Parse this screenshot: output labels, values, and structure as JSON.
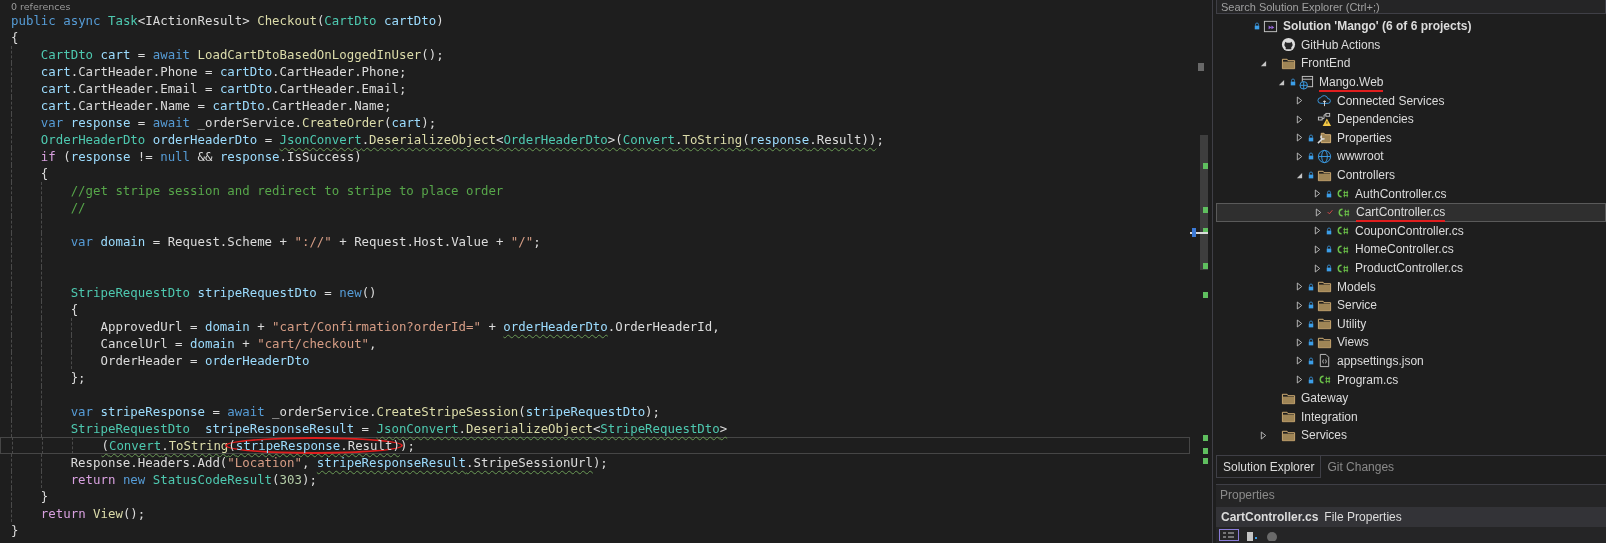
{
  "editor": {
    "lines": [
      {
        "kind": "codelens",
        "text": "0 references"
      },
      {
        "kind": "code",
        "tokens": [
          {
            "kind": "keyword",
            "text": "public async "
          },
          {
            "kind": "type",
            "text": "Task"
          },
          {
            "kind": "plain",
            "text": "<IActionResult> "
          },
          {
            "kind": "method",
            "text": "Checkout"
          },
          {
            "kind": "plain",
            "text": "("
          },
          {
            "kind": "type",
            "text": "CartDto"
          },
          {
            "kind": "variable",
            "text": " cartDto"
          },
          {
            "kind": "plain",
            "text": ")"
          }
        ]
      },
      {
        "kind": "code",
        "tokens": [
          {
            "kind": "plain",
            "text": "{"
          }
        ]
      },
      {
        "kind": "block",
        "lines": [
          {
            "kind": "code",
            "tokens": [
              {
                "kind": "type",
                "text": "CartDto"
              },
              {
                "kind": "variable",
                "text": " cart"
              },
              {
                "kind": "plain",
                "text": " = "
              },
              {
                "kind": "keyword",
                "text": "await "
              },
              {
                "kind": "method",
                "text": "LoadCartDtoBasedOnLoggedInUser"
              },
              {
                "kind": "plain",
                "text": "();"
              }
            ]
          },
          {
            "kind": "code",
            "tokens": [
              {
                "kind": "variable",
                "text": "cart"
              },
              {
                "kind": "plain",
                "text": ".CartHeader.Phone = "
              },
              {
                "kind": "variable",
                "text": "cartDto"
              },
              {
                "kind": "plain",
                "text": ".CartHeader.Phone;"
              }
            ]
          },
          {
            "kind": "code",
            "tokens": [
              {
                "kind": "variable",
                "text": "cart"
              },
              {
                "kind": "plain",
                "text": ".CartHeader.Email = "
              },
              {
                "kind": "variable",
                "text": "cartDto"
              },
              {
                "kind": "plain",
                "text": ".CartHeader.Email;"
              }
            ]
          },
          {
            "kind": "code",
            "tokens": [
              {
                "kind": "variable",
                "text": "cart"
              },
              {
                "kind": "plain",
                "text": ".CartHeader.Name = "
              },
              {
                "kind": "variable",
                "text": "cartDto"
              },
              {
                "kind": "plain",
                "text": ".CartHeader.Name;"
              }
            ]
          },
          {
            "kind": "code",
            "tokens": [
              {
                "kind": "keyword",
                "text": "var "
              },
              {
                "kind": "variable",
                "text": "response"
              },
              {
                "kind": "plain",
                "text": " = "
              },
              {
                "kind": "keyword",
                "text": "await "
              },
              {
                "kind": "plain",
                "text": "_orderService."
              },
              {
                "kind": "method",
                "text": "CreateOrder"
              },
              {
                "kind": "plain",
                "text": "("
              },
              {
                "kind": "variable",
                "text": "cart"
              },
              {
                "kind": "plain",
                "text": ");"
              }
            ]
          },
          {
            "kind": "code",
            "tokens": [
              {
                "kind": "type",
                "text": "OrderHeaderDto"
              },
              {
                "kind": "variable",
                "text": " orderHeaderDto"
              },
              {
                "kind": "plain",
                "text": " = "
              },
              {
                "kind": "type",
                "text": "JsonConvert",
                "squiggle": true
              },
              {
                "kind": "plain",
                "text": ".",
                "squiggle": true
              },
              {
                "kind": "method",
                "text": "DeserializeObject",
                "squiggle": true
              },
              {
                "kind": "plain",
                "text": "<",
                "squiggle": true
              },
              {
                "kind": "type",
                "text": "OrderHeaderDto",
                "squiggle": true
              },
              {
                "kind": "plain",
                "text": ">(",
                "squiggle": true
              },
              {
                "kind": "type",
                "text": "Convert",
                "squiggle": true
              },
              {
                "kind": "plain",
                "text": ".",
                "squiggle": true
              },
              {
                "kind": "method",
                "text": "ToString",
                "squiggle": true
              },
              {
                "kind": "plain",
                "text": "(",
                "squiggle": true
              },
              {
                "kind": "variable",
                "text": "response",
                "squiggle": true
              },
              {
                "kind": "plain",
                "text": ".Result))",
                "squiggle": true
              },
              {
                "kind": "plain",
                "text": ";"
              }
            ]
          },
          {
            "kind": "code",
            "tokens": [
              {
                "kind": "control",
                "text": "if"
              },
              {
                "kind": "plain",
                "text": " ("
              },
              {
                "kind": "variable",
                "text": "response"
              },
              {
                "kind": "plain",
                "text": " != "
              },
              {
                "kind": "keyword",
                "text": "null"
              },
              {
                "kind": "plain",
                "text": " && "
              },
              {
                "kind": "variable",
                "text": "response"
              },
              {
                "kind": "plain",
                "text": ".IsSuccess)"
              }
            ]
          },
          {
            "kind": "code",
            "tokens": [
              {
                "kind": "plain",
                "text": "{"
              }
            ]
          },
          {
            "kind": "block",
            "lines": [
              {
                "kind": "code",
                "tokens": [
                  {
                    "kind": "comment",
                    "text": "//get stripe session and redirect to stripe to place order"
                  }
                ]
              },
              {
                "kind": "code",
                "tokens": [
                  {
                    "kind": "comment",
                    "text": "//"
                  }
                ]
              },
              {
                "kind": "blank"
              },
              {
                "kind": "code",
                "tokens": [
                  {
                    "kind": "keyword",
                    "text": "var "
                  },
                  {
                    "kind": "variable",
                    "text": "domain"
                  },
                  {
                    "kind": "plain",
                    "text": " = Request.Scheme + "
                  },
                  {
                    "kind": "string",
                    "text": "\"://\""
                  },
                  {
                    "kind": "plain",
                    "text": " + Request.Host.Value + "
                  },
                  {
                    "kind": "string",
                    "text": "\"/\""
                  },
                  {
                    "kind": "plain",
                    "text": ";"
                  }
                ]
              },
              {
                "kind": "blank"
              },
              {
                "kind": "blank"
              },
              {
                "kind": "code",
                "tokens": [
                  {
                    "kind": "type",
                    "text": "StripeRequestDto"
                  },
                  {
                    "kind": "variable",
                    "text": " stripeRequestDto"
                  },
                  {
                    "kind": "plain",
                    "text": " = "
                  },
                  {
                    "kind": "keyword",
                    "text": "new"
                  },
                  {
                    "kind": "plain",
                    "text": "()"
                  }
                ]
              },
              {
                "kind": "code",
                "tokens": [
                  {
                    "kind": "plain",
                    "text": "{"
                  }
                ]
              },
              {
                "kind": "block",
                "lines": [
                  {
                    "kind": "code",
                    "tokens": [
                      {
                        "kind": "plain",
                        "text": "ApprovedUrl = "
                      },
                      {
                        "kind": "variable",
                        "text": "domain"
                      },
                      {
                        "kind": "plain",
                        "text": " + "
                      },
                      {
                        "kind": "string",
                        "text": "\"cart/Confirmation?orderId=\""
                      },
                      {
                        "kind": "plain",
                        "text": " + "
                      },
                      {
                        "kind": "variable",
                        "text": "orderHeaderDto",
                        "squiggle": true
                      },
                      {
                        "kind": "plain",
                        "text": ".OrderHeaderId,"
                      }
                    ]
                  },
                  {
                    "kind": "code",
                    "tokens": [
                      {
                        "kind": "plain",
                        "text": "CancelUrl = "
                      },
                      {
                        "kind": "variable",
                        "text": "domain"
                      },
                      {
                        "kind": "plain",
                        "text": " + "
                      },
                      {
                        "kind": "string",
                        "text": "\"cart/checkout\""
                      },
                      {
                        "kind": "plain",
                        "text": ","
                      }
                    ]
                  },
                  {
                    "kind": "code",
                    "tokens": [
                      {
                        "kind": "plain",
                        "text": "OrderHeader = "
                      },
                      {
                        "kind": "variable",
                        "text": "orderHeaderDto"
                      }
                    ]
                  }
                ]
              },
              {
                "kind": "code",
                "tokens": [
                  {
                    "kind": "plain",
                    "text": "};"
                  }
                ]
              },
              {
                "kind": "blank"
              },
              {
                "kind": "code",
                "tokens": [
                  {
                    "kind": "keyword",
                    "text": "var "
                  },
                  {
                    "kind": "variable",
                    "text": "stripeResponse"
                  },
                  {
                    "kind": "plain",
                    "text": " = "
                  },
                  {
                    "kind": "keyword",
                    "text": "await "
                  },
                  {
                    "kind": "plain",
                    "text": "_orderService."
                  },
                  {
                    "kind": "method",
                    "text": "CreateStripeSession"
                  },
                  {
                    "kind": "plain",
                    "text": "("
                  },
                  {
                    "kind": "variable",
                    "text": "stripeRequestDto"
                  },
                  {
                    "kind": "plain",
                    "text": ");"
                  }
                ]
              },
              {
                "kind": "code",
                "tokens": [
                  {
                    "kind": "type",
                    "text": "StripeRequestDto"
                  },
                  {
                    "kind": "variable",
                    "text": "  stripeResponseResult"
                  },
                  {
                    "kind": "plain",
                    "text": " = "
                  },
                  {
                    "kind": "type",
                    "text": "JsonConvert",
                    "squiggle": true
                  },
                  {
                    "kind": "plain",
                    "text": ".",
                    "squiggle": true
                  },
                  {
                    "kind": "method",
                    "text": "DeserializeObject",
                    "squiggle": true
                  },
                  {
                    "kind": "plain",
                    "text": "<",
                    "squiggle": true
                  },
                  {
                    "kind": "type",
                    "text": "StripeRequestDto",
                    "squiggle": true
                  },
                  {
                    "kind": "plain",
                    "text": ">",
                    "squiggle": true
                  }
                ]
              },
              {
                "kind": "block",
                "lines": [
                  {
                    "kind": "code",
                    "current": true,
                    "tokens": [
                      {
                        "kind": "plain",
                        "text": "(",
                        "squiggle": true
                      },
                      {
                        "kind": "type",
                        "text": "Convert",
                        "squiggle": true
                      },
                      {
                        "kind": "plain",
                        "text": ".",
                        "squiggle": true
                      },
                      {
                        "kind": "method",
                        "text": "ToString",
                        "squiggle": true
                      },
                      {
                        "kind": "group",
                        "circled": true,
                        "tokens": [
                          {
                            "kind": "plain",
                            "text": "(",
                            "squiggle": true
                          },
                          {
                            "kind": "variable",
                            "text": "stripeResponse",
                            "squiggle": true
                          },
                          {
                            "kind": "plain",
                            "text": ".Result)",
                            "squiggle": true
                          }
                        ]
                      },
                      {
                        "kind": "plain",
                        "text": ");"
                      }
                    ]
                  }
                ]
              },
              {
                "kind": "code",
                "tokens": [
                  {
                    "kind": "plain",
                    "text": "Response.Headers.Add("
                  },
                  {
                    "kind": "string",
                    "text": "\"Location\""
                  },
                  {
                    "kind": "plain",
                    "text": ", "
                  },
                  {
                    "kind": "variable",
                    "text": "stripeResponseResult",
                    "squiggle": true
                  },
                  {
                    "kind": "plain",
                    "text": ".StripeSessionUrl",
                    "squiggle": true
                  },
                  {
                    "kind": "plain",
                    "text": ");"
                  }
                ]
              },
              {
                "kind": "code",
                "tokens": [
                  {
                    "kind": "control",
                    "text": "return"
                  },
                  {
                    "kind": "keyword",
                    "text": " new"
                  },
                  {
                    "kind": "type",
                    "text": " StatusCodeResult"
                  },
                  {
                    "kind": "plain",
                    "text": "("
                  },
                  {
                    "kind": "number",
                    "text": "303"
                  },
                  {
                    "kind": "plain",
                    "text": ");"
                  }
                ]
              }
            ]
          },
          {
            "kind": "code",
            "tokens": [
              {
                "kind": "plain",
                "text": "}"
              }
            ]
          },
          {
            "kind": "code",
            "tokens": [
              {
                "kind": "control",
                "text": "return"
              },
              {
                "kind": "method",
                "text": " View"
              },
              {
                "kind": "plain",
                "text": "();"
              }
            ]
          }
        ]
      },
      {
        "kind": "code",
        "tokens": [
          {
            "kind": "plain",
            "text": "}"
          }
        ]
      }
    ]
  },
  "explorer": {
    "search": {
      "placeholder": "Search Solution Explorer (Ctrl+;)"
    },
    "tree": [
      {
        "label": "Solution 'Mango' (6 of 6 projects)",
        "kind": "solution",
        "locked": true,
        "modified": false,
        "selected": false,
        "underlined": false,
        "children": [
          {
            "label": "GitHub Actions",
            "kind": "github",
            "locked": false,
            "modified": false,
            "selected": false,
            "underlined": false
          },
          {
            "label": "FrontEnd",
            "kind": "folder",
            "expanded": true,
            "locked": false,
            "modified": false,
            "selected": false,
            "underlined": false,
            "children": [
              {
                "label": "Mango.Web",
                "kind": "web-project",
                "expanded": true,
                "locked": true,
                "modified": false,
                "selected": false,
                "underlined": true,
                "children": [
                  {
                    "label": "Connected Services",
                    "kind": "cloud",
                    "expanded": false,
                    "locked": false,
                    "modified": false,
                    "selected": false,
                    "underlined": false
                  },
                  {
                    "label": "Dependencies",
                    "kind": "dependencies",
                    "expanded": false,
                    "locked": false,
                    "modified": false,
                    "selected": false,
                    "underlined": false
                  },
                  {
                    "label": "Properties",
                    "kind": "properties",
                    "expanded": false,
                    "locked": true,
                    "modified": false,
                    "selected": false,
                    "underlined": false
                  },
                  {
                    "label": "wwwroot",
                    "kind": "globe",
                    "expanded": false,
                    "locked": true,
                    "modified": false,
                    "selected": false,
                    "underlined": false
                  },
                  {
                    "label": "Controllers",
                    "kind": "folder",
                    "expanded": true,
                    "locked": true,
                    "modified": false,
                    "selected": false,
                    "underlined": false,
                    "children": [
                      {
                        "label": "AuthController.cs",
                        "kind": "csharp",
                        "expanded": false,
                        "locked": true,
                        "modified": false,
                        "selected": false,
                        "underlined": false
                      },
                      {
                        "label": "CartController.cs",
                        "kind": "csharp",
                        "expanded": false,
                        "locked": false,
                        "modified": true,
                        "selected": true,
                        "underlined": true
                      },
                      {
                        "label": "CouponController.cs",
                        "kind": "csharp",
                        "expanded": false,
                        "locked": true,
                        "modified": false,
                        "selected": false,
                        "underlined": false
                      },
                      {
                        "label": "HomeController.cs",
                        "kind": "csharp",
                        "expanded": false,
                        "locked": true,
                        "modified": false,
                        "selected": false,
                        "underlined": false
                      },
                      {
                        "label": "ProductController.cs",
                        "kind": "csharp",
                        "expanded": false,
                        "locked": true,
                        "modified": false,
                        "selected": false,
                        "underlined": false
                      }
                    ]
                  },
                  {
                    "label": "Models",
                    "kind": "folder",
                    "expanded": false,
                    "locked": true,
                    "modified": false,
                    "selected": false,
                    "underlined": false
                  },
                  {
                    "label": "Service",
                    "kind": "folder",
                    "expanded": false,
                    "locked": true,
                    "modified": false,
                    "selected": false,
                    "underlined": false
                  },
                  {
                    "label": "Utility",
                    "kind": "folder",
                    "expanded": false,
                    "locked": true,
                    "modified": false,
                    "selected": false,
                    "underlined": false
                  },
                  {
                    "label": "Views",
                    "kind": "folder",
                    "expanded": false,
                    "locked": true,
                    "modified": false,
                    "selected": false,
                    "underlined": false
                  },
                  {
                    "label": "appsettings.json",
                    "kind": "json",
                    "expanded": false,
                    "locked": true,
                    "modified": false,
                    "selected": false,
                    "underlined": false
                  },
                  {
                    "label": "Program.cs",
                    "kind": "csharp",
                    "expanded": false,
                    "locked": true,
                    "modified": false,
                    "selected": false,
                    "underlined": false
                  }
                ]
              }
            ]
          },
          {
            "label": "Gateway",
            "kind": "folder",
            "locked": false,
            "modified": false,
            "selected": false,
            "underlined": false
          },
          {
            "label": "Integration",
            "kind": "folder",
            "locked": false,
            "modified": false,
            "selected": false,
            "underlined": false
          },
          {
            "label": "Services",
            "kind": "folder",
            "expanded": false,
            "locked": false,
            "modified": false,
            "selected": false,
            "underlined": false
          }
        ]
      }
    ],
    "tabs": [
      {
        "label": "Solution Explorer",
        "selected": true
      },
      {
        "label": "Git Changes",
        "selected": false
      }
    ]
  },
  "properties": {
    "title": "Properties",
    "object_name": "CartController.cs",
    "object_type": "File Properties"
  }
}
